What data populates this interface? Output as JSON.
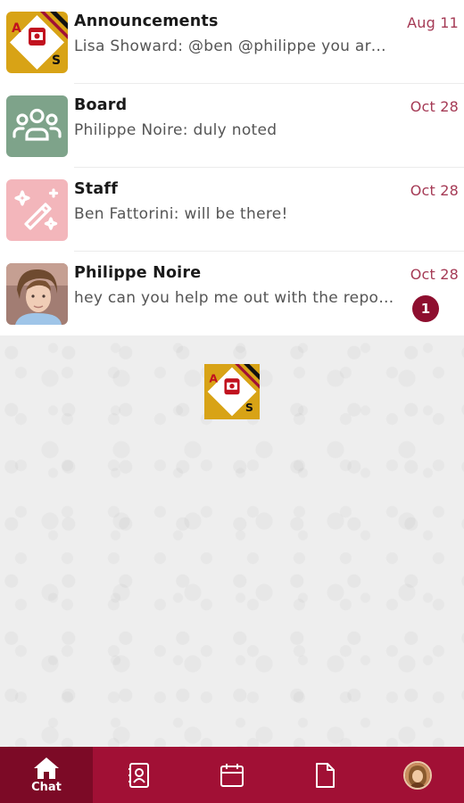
{
  "chats": [
    {
      "name": "Announcements",
      "preview": "Lisa Showard: @ben @philippe you are g...",
      "date": "Aug 11",
      "avatar_icon": "organization-logo-icon"
    },
    {
      "name": "Board",
      "preview": "Philippe Noire: duly noted",
      "date": "Oct 28",
      "avatar_icon": "group-people-icon"
    },
    {
      "name": "Staff",
      "preview": "Ben Fattorini: will be there!",
      "date": "Oct 28",
      "avatar_icon": "magic-wand-icon"
    },
    {
      "name": "Philippe Noire",
      "preview": "hey can you help me out with the report?",
      "date": "Oct 28",
      "unread": "1",
      "avatar_icon": "user-photo"
    }
  ],
  "logo": {
    "letter_a": "A",
    "letter_s": "S"
  },
  "nav": {
    "chat_label": "Chat"
  },
  "colors": {
    "brand": "#a11035",
    "brand_dark": "#7c0a26",
    "date": "#a53a55",
    "board": "#7ea38a",
    "staff": "#f3b6bb",
    "logo_gold": "#d8a316"
  }
}
